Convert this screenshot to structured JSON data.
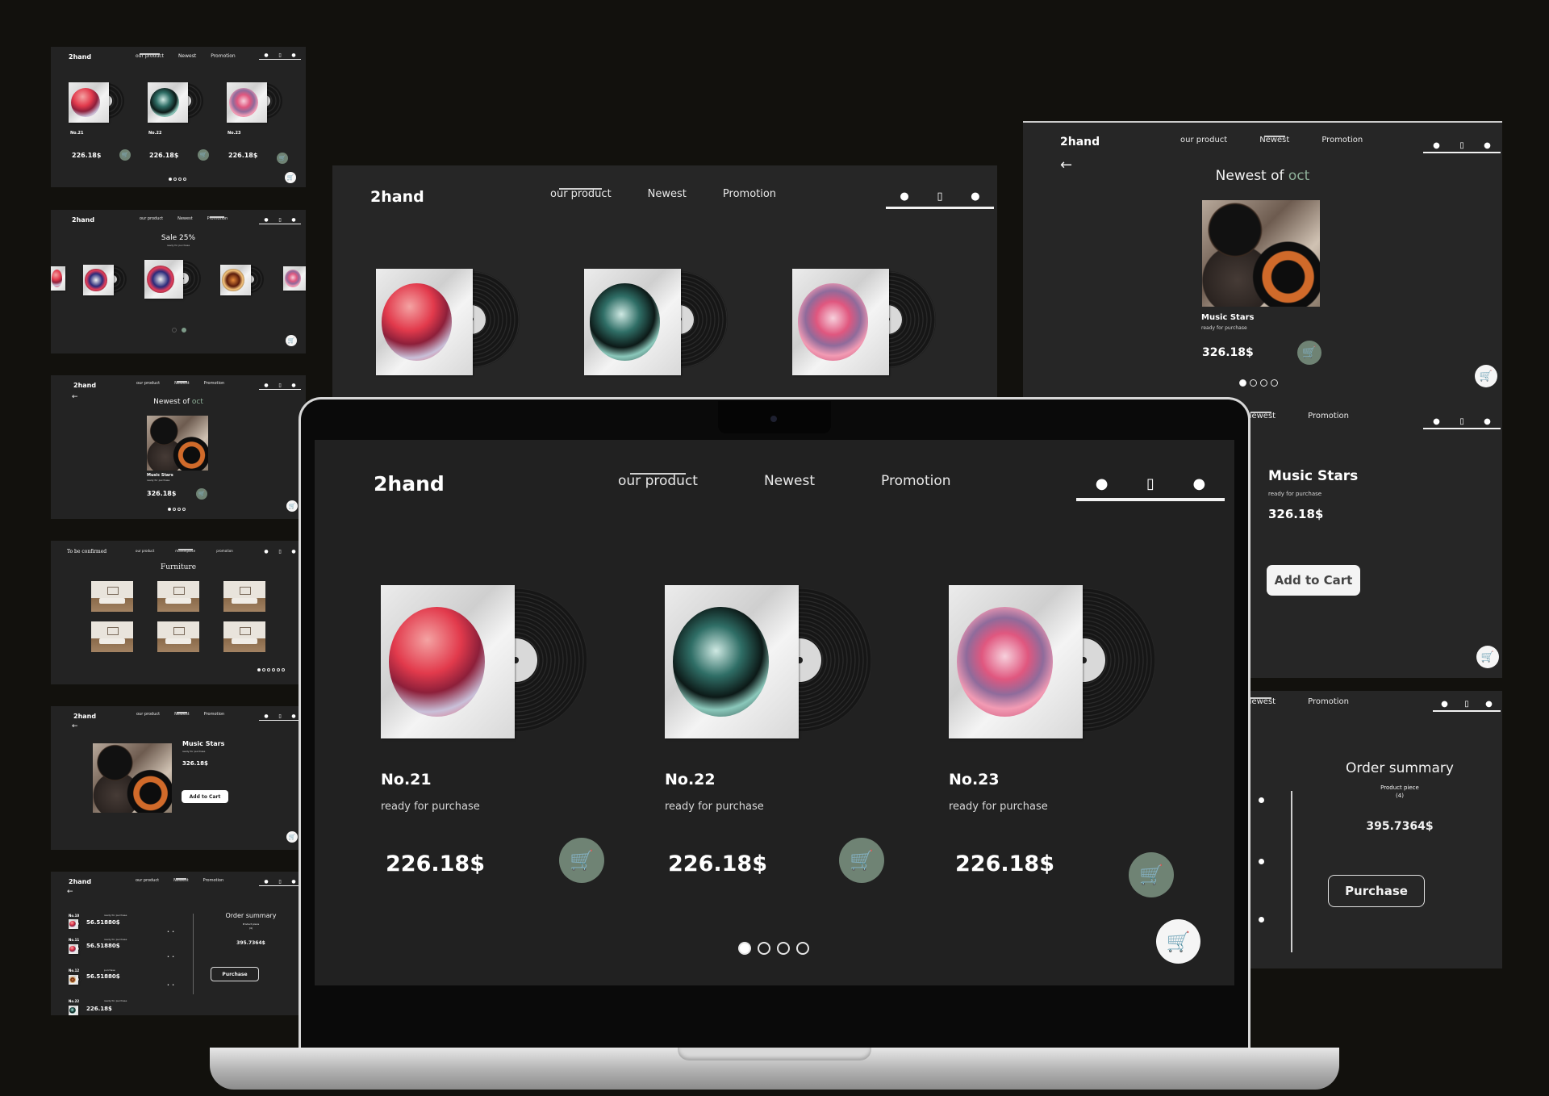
{
  "brand": "2hand",
  "nav": {
    "our_product": "our product",
    "newest": "Newest",
    "promotion": "Promotion"
  },
  "icons": {
    "facebook": "facebook-icon",
    "phone": "phone-icon",
    "info": "info-icon",
    "cart": "cart-icon",
    "back": "arrow-left-icon"
  },
  "colors": {
    "background": "#232323",
    "cart_button": "#6f8374",
    "accent_green": "#8fb19a"
  },
  "products": [
    {
      "name": "No.21",
      "status": "ready for purchase",
      "price": "226.18$"
    },
    {
      "name": "No.22",
      "status": "ready for purchase",
      "price": "226.18$"
    },
    {
      "name": "No.23",
      "status": "ready for purchase",
      "price": "226.18$"
    }
  ],
  "pagination": {
    "pages": 4,
    "current": 1
  },
  "sale": {
    "title": "Sale 25%",
    "subtitle": "ready for purchase"
  },
  "newest": {
    "title_prefix": "Newest of",
    "title_accent": "oct",
    "product_name": "Music Stars",
    "product_status": "ready for purchase",
    "product_price": "326.18$"
  },
  "furniture": {
    "brand": "To be confirmed",
    "nav_middle": "marketplace",
    "nav_right": "promotion",
    "title": "Furniture"
  },
  "detail": {
    "name": "Music Stars",
    "status": "ready for purchase",
    "price": "326.18$",
    "add_to_cart": "Add to Cart"
  },
  "order": {
    "title": "Order summary",
    "piece_label": "Product piece",
    "piece_count": "(4)",
    "total": "395.7364$",
    "purchase": "Purchase",
    "items": [
      {
        "name": "No.10",
        "status": "ready for purchase",
        "price": "56.51880$"
      },
      {
        "name": "No.11",
        "status": "ready for purchase",
        "price": "56.51880$"
      },
      {
        "name": "No.12",
        "status": "purchase",
        "price": "56.51880$"
      },
      {
        "name": "No.22",
        "status": "ready for purchase",
        "price": "226.18$"
      }
    ]
  }
}
